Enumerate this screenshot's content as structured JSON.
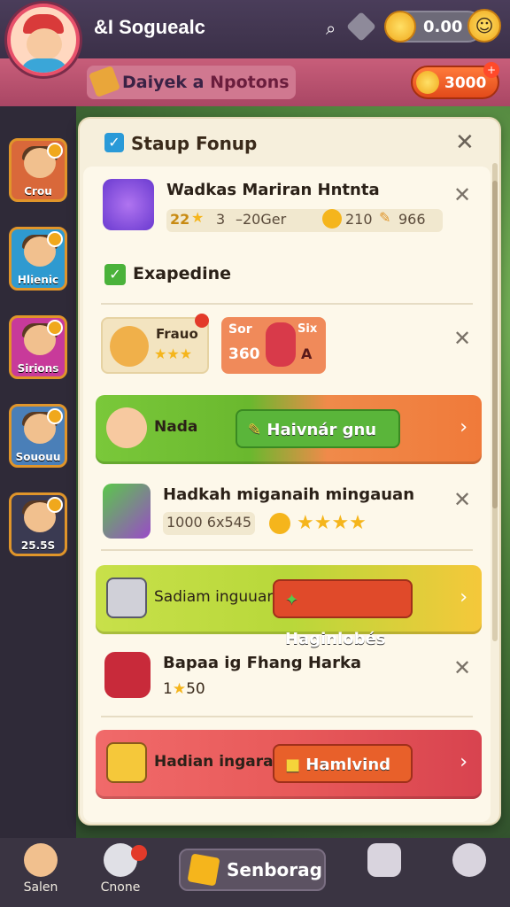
{
  "header": {
    "player_name": "&I Soguealc",
    "coins": "0.00",
    "subtitle_part1": "Daiyek a ",
    "subtitle_part2": "Npotons",
    "gold": "3000"
  },
  "sidebar": {
    "items": [
      {
        "label": "Crou",
        "color": "#d9683a"
      },
      {
        "label": "Hlienic",
        "color": "#2f9ad0"
      },
      {
        "label": "Sirions",
        "color": "#c83a9a"
      },
      {
        "label": "Sououu",
        "color": "#4a7fb8"
      },
      {
        "label": "25.5S",
        "color": "#3a3a52"
      }
    ]
  },
  "panel": {
    "title": "Staup Fonup",
    "task1": {
      "title": "Wadkas Mariran Hntnta",
      "reward_a": "22",
      "reward_b": "3",
      "reward_c": "–20Ger",
      "reward_d": "210",
      "reward_e": "966"
    },
    "section_title": "Exapedine",
    "mini_card_1": {
      "name": "Frauo"
    },
    "mini_card_2": {
      "label_a": "Sor",
      "label_b": "Six",
      "value": "360",
      "label_c": "A"
    },
    "banner1": {
      "label": "Nada",
      "button": "Haivnár gnu"
    },
    "task2": {
      "title": "Hadkah miganaih mingauan",
      "code": "1000 6x545"
    },
    "banner2": {
      "label": "Sadiam inguuar",
      "button": "Haginlobés"
    },
    "task3": {
      "title": "Bapaa ig Fhang Harka",
      "reward_prefix": "1",
      "reward_suffix": "50"
    },
    "banner3": {
      "label": "Hadian ingarar",
      "button": "Hamlvind"
    }
  },
  "bottom_nav": {
    "item1": "Salen",
    "item2": "Cnone",
    "center": "Senborag",
    "item4": "",
    "item5": ""
  },
  "colors": {
    "accent_green": "#4ab23a",
    "accent_orange": "#f0733a",
    "accent_red": "#d84a4a",
    "panel_bg": "#f6efdc"
  }
}
